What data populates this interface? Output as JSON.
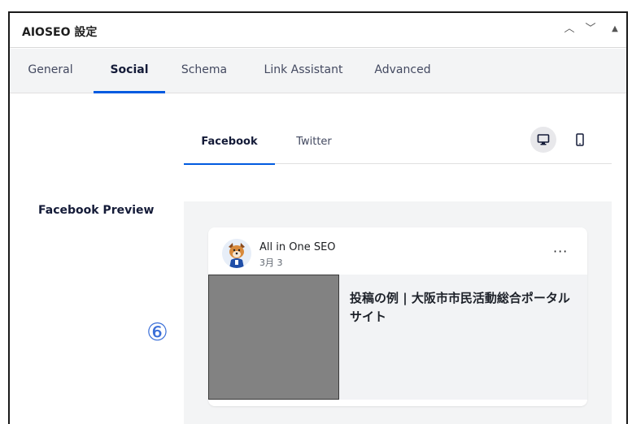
{
  "metabox": {
    "title": "AIOSEO 設定",
    "controls": {
      "up": "︿",
      "down": "﹀",
      "toggle": "▲"
    }
  },
  "main_tabs": [
    {
      "label": "General"
    },
    {
      "label": "Social",
      "active": true
    },
    {
      "label": "Schema"
    },
    {
      "label": "Link Assistant"
    },
    {
      "label": "Advanced"
    }
  ],
  "social": {
    "sub_tabs": [
      {
        "label": "Facebook",
        "active": true
      },
      {
        "label": "Twitter"
      }
    ],
    "device_icons": [
      "desktop-icon",
      "mobile-icon"
    ],
    "preview_label": "Facebook Preview",
    "fb_preview": {
      "author": "All in One SEO",
      "date": "3月 3",
      "more": "···",
      "title": "投稿の例 | 大阪市市民活動総合ポータルサイト"
    }
  },
  "annotation": "⑥",
  "colors": {
    "accent": "#005ae0",
    "tabbar_bg": "#f3f4f5",
    "preview_bg": "#f3f4f5",
    "redacted_image": "#828282",
    "annotation": "#3b6fd8"
  }
}
